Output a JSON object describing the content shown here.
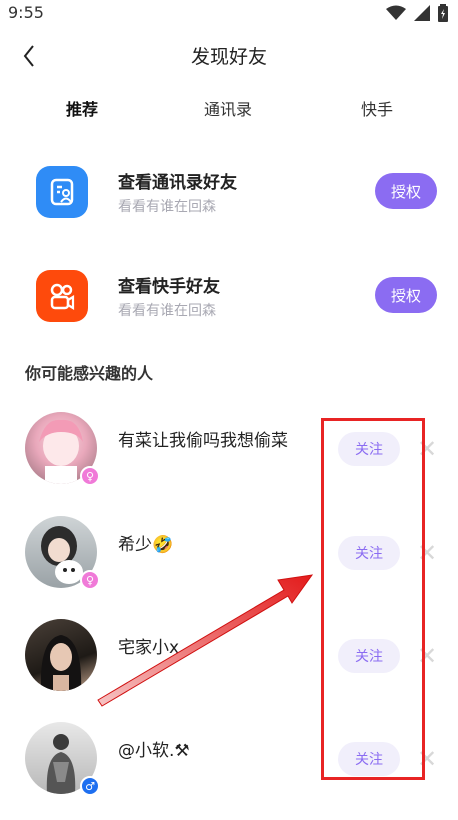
{
  "status_bar": {
    "time": "9:55"
  },
  "header": {
    "title": "发现好友"
  },
  "tabs": [
    {
      "label": "推荐",
      "active": true
    },
    {
      "label": "通讯录",
      "active": false
    },
    {
      "label": "快手",
      "active": false
    }
  ],
  "auth_items": [
    {
      "title": "查看通讯录好友",
      "subtitle": "看看有谁在回森",
      "button": "授权",
      "icon": "contacts-icon",
      "icon_color": "#2f8cf6"
    },
    {
      "title": "查看快手好友",
      "subtitle": "看看有谁在回森",
      "button": "授权",
      "icon": "kuaishou-icon",
      "icon_color": "#fe4a0c"
    }
  ],
  "section": {
    "title": "你可能感兴趣的人"
  },
  "users": [
    {
      "name": "有菜让我偷吗我想偷菜",
      "gender": "female",
      "gender_symbol": "♀",
      "follow": "关注"
    },
    {
      "name": "希少🤣",
      "gender": "female",
      "gender_symbol": "♀",
      "follow": "关注"
    },
    {
      "name": "宅家小x",
      "gender": "",
      "gender_symbol": "",
      "follow": "关注"
    },
    {
      "name": "@小软.⚒",
      "gender": "male",
      "gender_symbol": "♂",
      "follow": "关注"
    }
  ],
  "colors": {
    "accent": "#8b6cf2",
    "follow_bg": "#f1effb",
    "tab_underline": "#ffe23b",
    "highlight": "#e82424"
  }
}
